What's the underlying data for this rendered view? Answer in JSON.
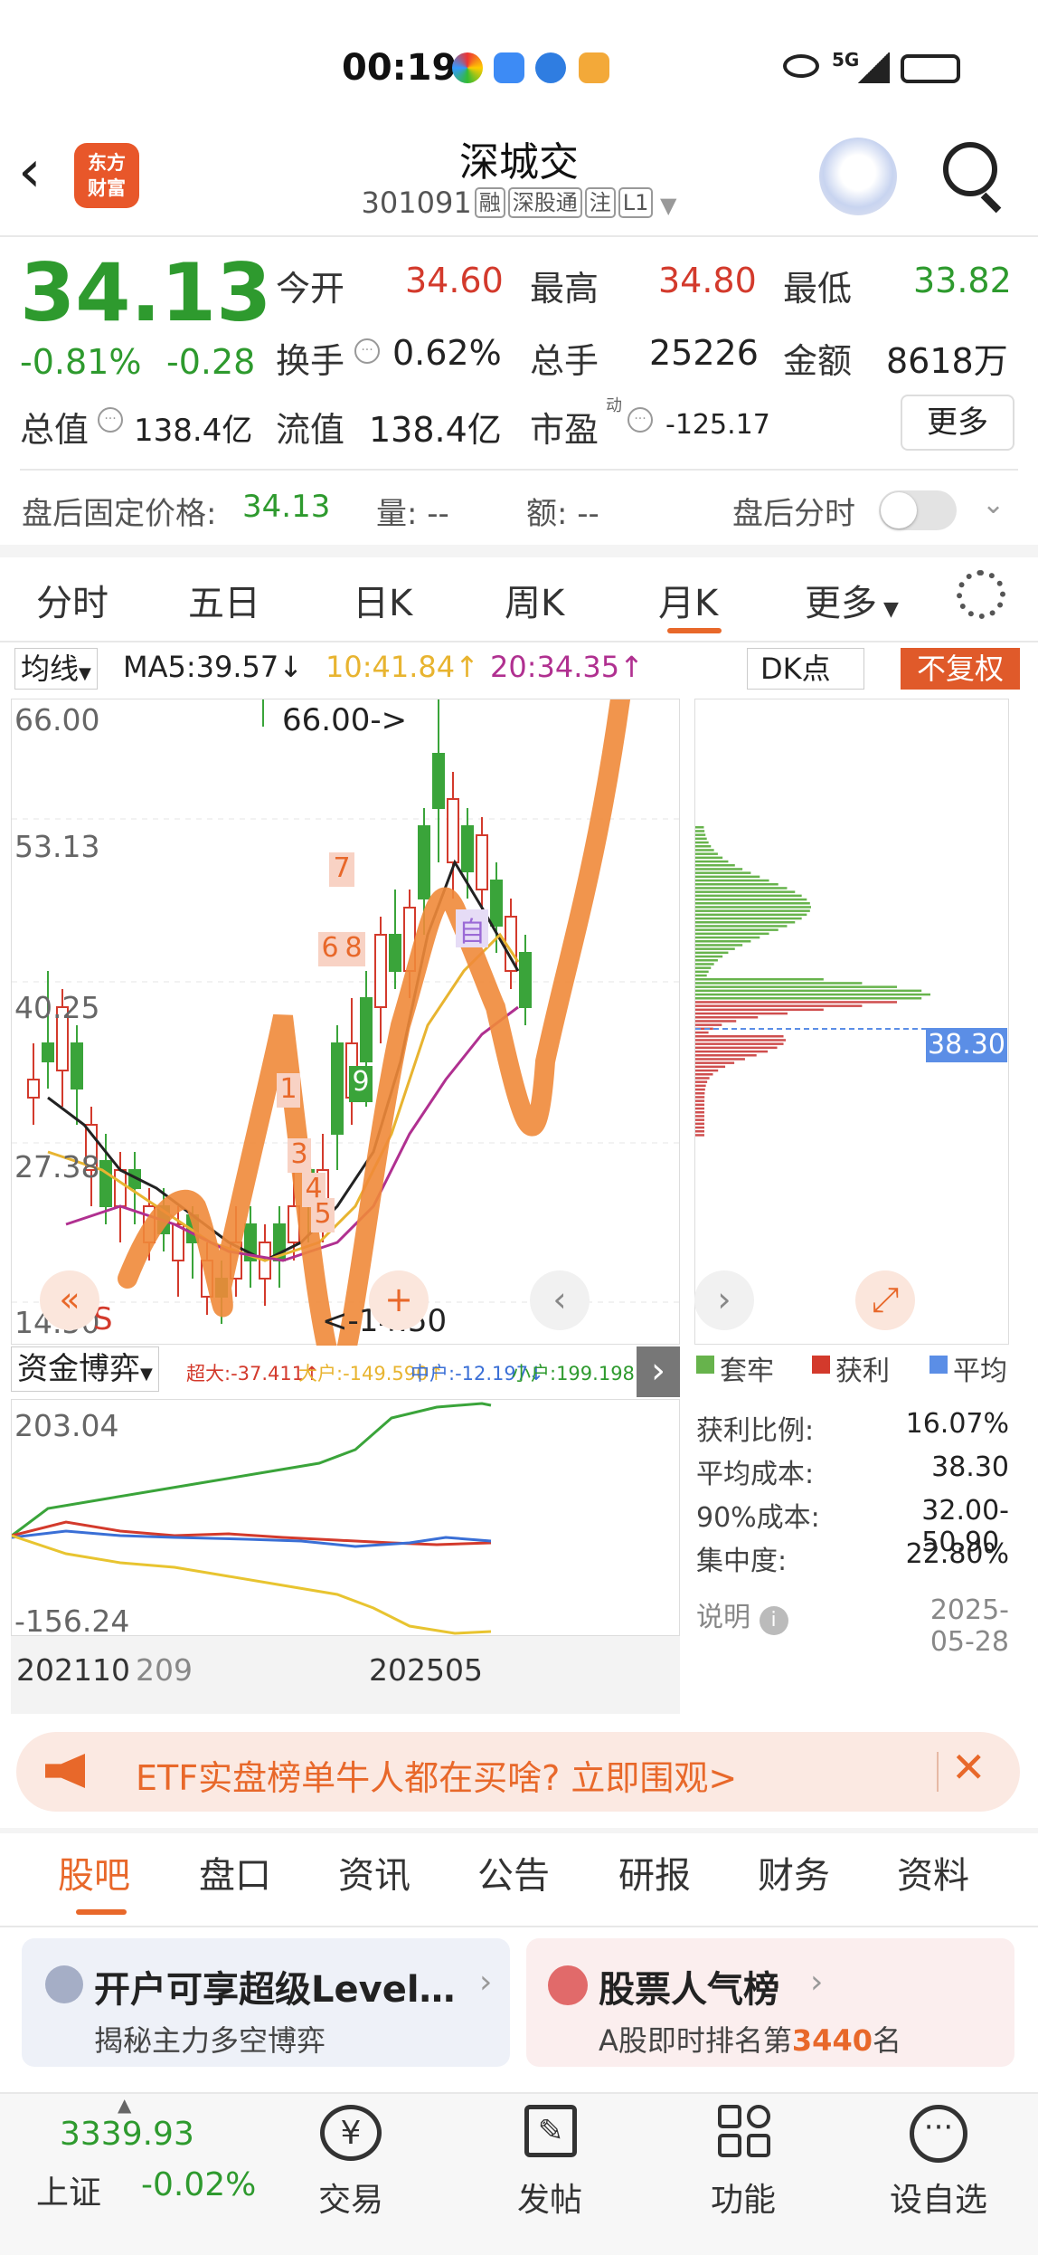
{
  "status": {
    "time": "00:19",
    "network": "5G"
  },
  "header": {
    "logo_text": "东方\n财富",
    "title": "深城交",
    "code": "301091",
    "tags": [
      "融",
      "深股通",
      "注",
      "L1"
    ]
  },
  "quote": {
    "price": "34.13",
    "change_pct": "-0.81%",
    "change": "-0.28",
    "fields": [
      {
        "label": "今开",
        "value": "34.60"
      },
      {
        "label": "最高",
        "value": "34.80"
      },
      {
        "label": "最低",
        "value": "33.82"
      },
      {
        "label": "换手",
        "value": "0.62%"
      },
      {
        "label": "总手",
        "value": "25226"
      },
      {
        "label": "金额",
        "value": "8618万"
      },
      {
        "label": "总值",
        "value": "138.4亿"
      },
      {
        "label": "流值",
        "value": "138.4亿"
      },
      {
        "label": "市盈",
        "super": "动",
        "value": "-125.17"
      }
    ],
    "more_button": "更多"
  },
  "afterhours": {
    "price_label": "盘后固定价格:",
    "price": "34.13",
    "volume": "量: --",
    "amount": "额: --",
    "timeshare_label": "盘后分时"
  },
  "tabs": {
    "items": [
      "分时",
      "五日",
      "日K",
      "周K",
      "月K",
      "更多"
    ],
    "active": "月K"
  },
  "ma_bar": {
    "select": "均线",
    "ma5": "MA5:39.57",
    "ma10": "10:41.84",
    "ma20": "20:34.35",
    "dk": "DK点",
    "adjust": "不复权"
  },
  "kchart": {
    "y_ticks": [
      "66.00",
      "53.13",
      "40.25",
      "27.38",
      "14.50"
    ],
    "max_label": "66.00->",
    "min_label": "<-14.50",
    "marks": [
      "7",
      "6",
      "8",
      "9",
      "3",
      "4",
      "5",
      "1",
      "自"
    ],
    "s_mark": "S"
  },
  "chip": {
    "avg_cost_label": "38.30",
    "legend": [
      "套牢",
      "获利",
      "平均"
    ],
    "stats": [
      {
        "label": "获利比例:",
        "value": "16.07%"
      },
      {
        "label": "平均成本:",
        "value": "38.30"
      },
      {
        "label": "90%成本:",
        "value": "32.00-50.90"
      },
      {
        "label": "集中度:",
        "value": "22.80%"
      }
    ],
    "note_label": "说明",
    "date": "2025-05-28"
  },
  "fund": {
    "select": "资金博弈",
    "super": "超大:-37.411↑",
    "big": "大户:-149.590↑",
    "mid": "中户:-12.197↓",
    "small": "小户:199.198↓",
    "y_max": "203.04",
    "y_min": "-156.24",
    "x_left": "202110",
    "x_left2": "209",
    "x_right": "202505"
  },
  "banner": {
    "text": "ETF实盘榜单牛人都在买啥? 立即围观>"
  },
  "bottom_tabs": {
    "items": [
      "股吧",
      "盘口",
      "资讯",
      "公告",
      "研报",
      "财务",
      "资料"
    ],
    "active": "股吧"
  },
  "cards": [
    {
      "title": "开户可享超级Level…",
      "subtitle": "揭秘主力多空博弈"
    },
    {
      "title": "股票人气榜",
      "subtitle_pre": "A股即时排名第",
      "rank": "3440",
      "subtitle_post": "名"
    }
  ],
  "footer": {
    "index_value": "3339.93",
    "index_name": "上证",
    "index_change": "-0.02%",
    "items": [
      "交易",
      "发帖",
      "功能",
      "设自选"
    ]
  },
  "colors": {
    "up": "#d33a2c",
    "down": "#2e9a2e",
    "accent": "#e8682a",
    "chip_avg": "#5b8ee6"
  }
}
